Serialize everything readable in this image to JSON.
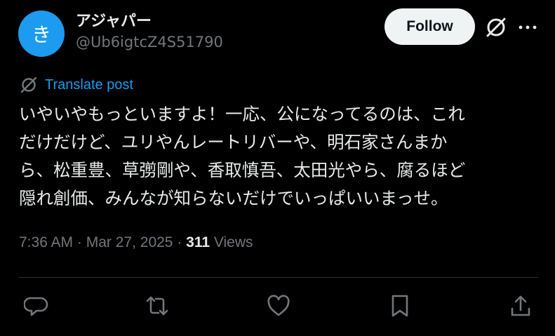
{
  "author": {
    "avatar_char": "き",
    "display_name": "アジャパー",
    "handle": "@Ub6igtcZ4S51790"
  },
  "follow_label": "Follow",
  "translate_label": "Translate post",
  "post": {
    "lines": [
      "いやいやもっといますよ！一応、公になってるのは、これ",
      "だけだけど、ユリやんレートリバーや、明石家さんまか",
      "ら、松重豊、草彅剛や、香取慎吾、太田光やら、腐るほど",
      "隠れ創価、みんなが知らないだけでいっぱいいまっせ。"
    ]
  },
  "meta": {
    "time": "7:36 AM",
    "sep1": " · ",
    "date": "Mar 27, 2025",
    "sep2": " · ",
    "views_count": "311",
    "views_label": " Views"
  },
  "colors": {
    "background": "#000000",
    "text": "#e7e9ea",
    "secondary": "#71767b",
    "accent": "#1d9bf0",
    "divider": "#2f3336"
  },
  "icons": [
    "grok-icon",
    "more-icon",
    "translate-icon",
    "reply-icon",
    "repost-icon",
    "like-icon",
    "bookmark-icon",
    "share-icon"
  ]
}
